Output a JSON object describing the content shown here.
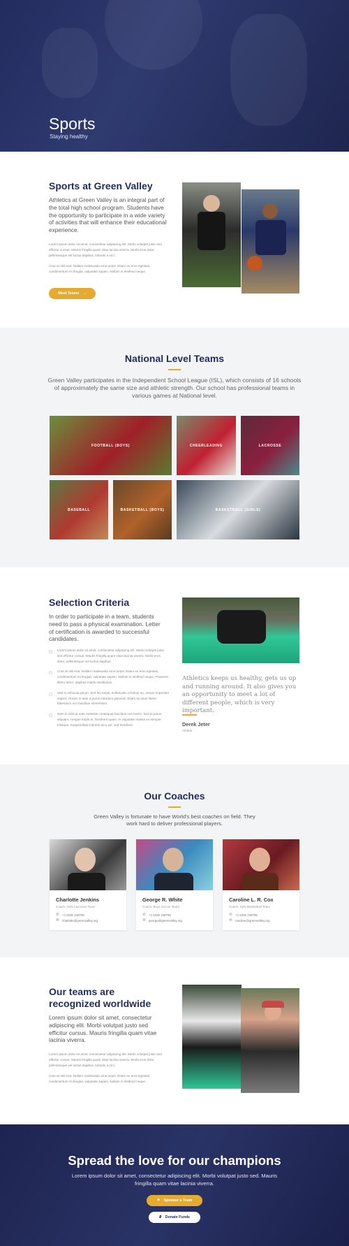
{
  "hero": {
    "title": "Sports",
    "subtitle": "Staying healthy"
  },
  "about": {
    "title": "Sports at Green Valley",
    "lead": "Athletics at Green Valley is an integral part of the total high school program. Students have the opportunity to participate in a wide variety of activities that will enhance their educational experience.",
    "p1": "Lorem ipsum dolor sit amet, consectetur adipiscing elit. Morbi volutpat justo sed efficitur cursus. Mauris fringilla quam vitae lacinia viverra. Morbi eros dolor, pellentesque vel luctus dapibus, lobortis a orci.",
    "p2": "Cras at nisl erat. Nullam malesuada urna turpis. Etiam eu eros egestas, condimentum mi feugiat, vulputate sapien. Nullam in eleifend neque.",
    "button": "Meet Teams"
  },
  "national": {
    "title": "National Level Teams",
    "lead": "Green Valley participates in the Independent School League (ISL), which consists of 16 schools of approximately the same size and athletic strength. Our school has professional teams in various games at National level.",
    "teams": [
      "FOOTBALL (BOYS)",
      "CHEERLEADING",
      "LACROSSE",
      "BASEBALL",
      "BASKETBALL (BOYS)",
      "BASKETBALL (GIRLS)"
    ]
  },
  "criteria": {
    "title": "Selection Criteria",
    "lead": "In order to participate in a team, students need to pass a physical examination. Letter of certification is awarded to successful candidates.",
    "bullets": [
      "Lorem ipsum dolor sit amet, consectetur adipiscing elit. Morbi volutpat justo sed efficitur cursus. Mauris fringilla quam vitae lacinia viverra. Morbi eros dolor, pellentesque vel luctus dapibus.",
      "Cras at nisl erat. Nullam malesuada urna turpis. Etiam eu eros egestas, condimentum mi feugiat, vulputate sapien. Nullam in eleifend neque. Praesent libero tortor, dapibus mattis vestibulum.",
      "Sed in vehicula ipsum. Sed leo turpis, sollicitudin a finibus eu, ornare imperdiet sapien. Donec in ante a purus interdum placerat. Etiam sit amet libero bibendum orci faucibus elementum.",
      "Nam in nibh at ante molestie consequat faucibus non lorem. Sed et purus aliquam, congue turpis et, hendrerit quam. In vulputate massa eu semper tristique. Suspendisse lobortis arcu vel, sed hendrerit."
    ],
    "quote": "Athletics keeps us healthy, gets us up and running around. It also gives you an opportunity to meet a lot of different people, which is very important.",
    "quote_author": "Derek Jeter",
    "quote_role": "Athlete"
  },
  "coaches": {
    "title": "Our Coaches",
    "lead": "Green Valley is fortunate to have World's best coaches on field. They work hard to deliver professional players.",
    "list": [
      {
        "name": "Charlotte Jenkins",
        "role": "Coach, Girls Lacrosse Team",
        "phone": "+1 6335 248795",
        "email": "charlotte@greenvalley.org"
      },
      {
        "name": "George R. White",
        "role": "Coach, Boys Soccer Team",
        "phone": "+1 6335 248795",
        "email": "george@greenvalley.org"
      },
      {
        "name": "Caroline L. R. Cox",
        "role": "Coach, Girls Basketball Team",
        "phone": "+1 6335 248795",
        "email": "caroline@greenvalley.org"
      }
    ]
  },
  "worldwide": {
    "title": "Our teams are recognized worldwide",
    "lead": "Lorem ipsum dolor sit amet, consectetur adipiscing elit. Morbi volutpat justo sed efficitur cursus. Mauris fringilla quam vitae lacinia viverra.",
    "p1": "Lorem ipsum dolor sit amet, consectetur adipiscing elit. Morbi volutpat justo sed efficitur cursus. Mauris fringilla quam vitae lacinia viverra. Morbi eros dolor, pellentesque vel luctus dapibus, lobortis a orci.",
    "p2": "Cras at nisl erat. Nullam malesuada urna turpis. Etiam eu eros egestas, condimentum mi feugiat, vulputate sapien. Nullam in eleifend neque."
  },
  "cta": {
    "title": "Spread the love for our champions",
    "lead": "Lorem ipsum dolor sit amet, consectetur adipiscing elit. Morbi volutpat justo sed. Mauris fringilla quam vitae lacinia viverra.",
    "sponsor": "Sponsor a Team",
    "donate": "Donate Funds"
  },
  "colors": {
    "navy": "#1f2c5c",
    "gold": "#e6ab2e",
    "light_bg": "#f3f4f6"
  }
}
